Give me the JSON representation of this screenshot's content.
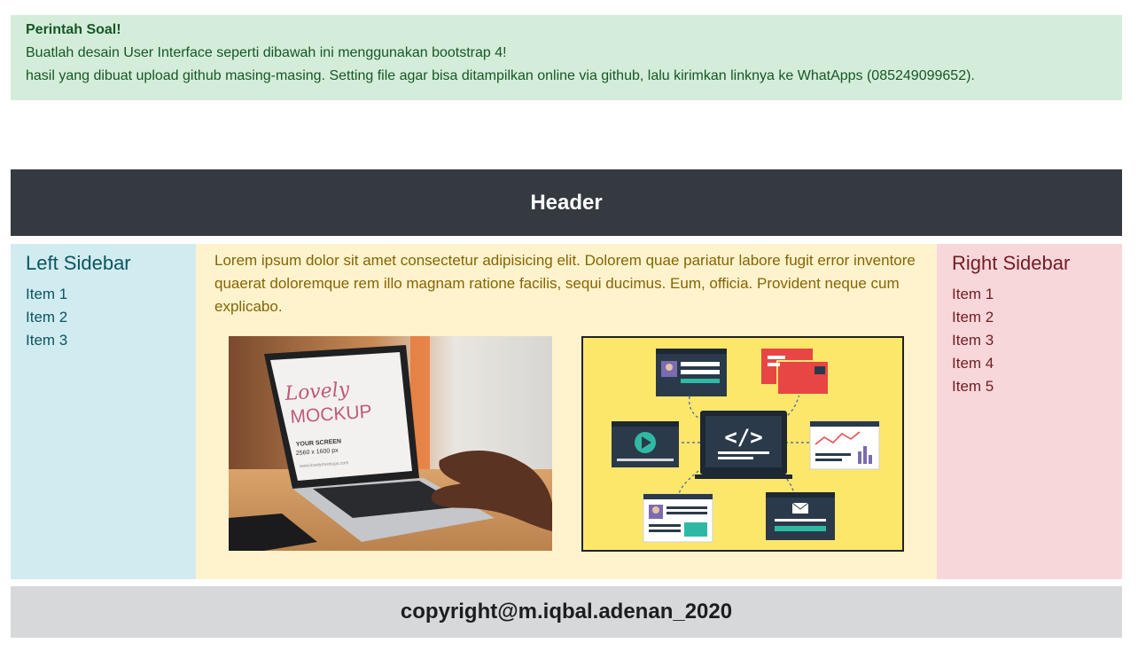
{
  "alert": {
    "title": "Perintah Soal!",
    "line1": "Buatlah desain User Interface seperti dibawah ini menggunakan bootstrap 4!",
    "line2": "hasil yang dibuat upload github masing-masing. Setting file agar bisa ditampilkan online via github, lalu kirimkan linknya ke WhatApps (085249099652)."
  },
  "header": {
    "title": "Header"
  },
  "left_sidebar": {
    "title": "Left Sidebar",
    "items": [
      "Item 1",
      "Item 2",
      "Item 3"
    ]
  },
  "main": {
    "text": "Lorem ipsum dolor sit amet consectetur adipisicing elit. Dolorem quae pariatur labore fugit error inventore quaerat doloremque rem illo magnam ratione facilis, sequi ducimus. Eum, officia. Provident neque cum explicabo.",
    "laptop_image": {
      "script_text": "Lovely",
      "mockup_text": "MOCKUP",
      "screen_label": "YOUR SCREEN",
      "screen_size": "2560 x 1600 px",
      "url_text": "www.lovelymockups.com"
    },
    "dev_image": {
      "code_glyph": "</>"
    }
  },
  "right_sidebar": {
    "title": "Right Sidebar",
    "items": [
      "Item 1",
      "Item 2",
      "Item 3",
      "Item 4",
      "Item 5"
    ]
  },
  "footer": {
    "text": "copyright@m.iqbal.adenan_2020"
  },
  "colors": {
    "alert_bg": "#d4edda",
    "header_bg": "#343a40",
    "left_bg": "#d1ecf1",
    "main_bg": "#fff3cd",
    "right_bg": "#f8d7da",
    "footer_bg": "#d6d8d9"
  }
}
